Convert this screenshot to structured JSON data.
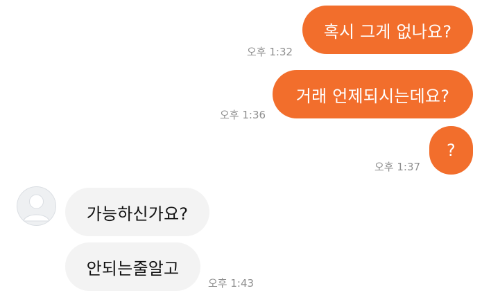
{
  "conversation": {
    "sent": [
      {
        "text": "혹시 그게 없나요?",
        "time": "오후 1:32"
      },
      {
        "text": "거래 언제되시는데요?",
        "time": "오후 1:36"
      },
      {
        "text": "?",
        "time": "오후 1:37"
      }
    ],
    "received": [
      {
        "text": "가능하신가요?"
      },
      {
        "text": "안되는줄알고",
        "time": "오후 1:43"
      }
    ]
  },
  "contact": {
    "avatar_icon": "default-profile-icon"
  },
  "colors": {
    "sent_bubble": "#f26e2c",
    "received_bubble": "#f3f3f3",
    "timestamp": "#8e8e8e"
  }
}
